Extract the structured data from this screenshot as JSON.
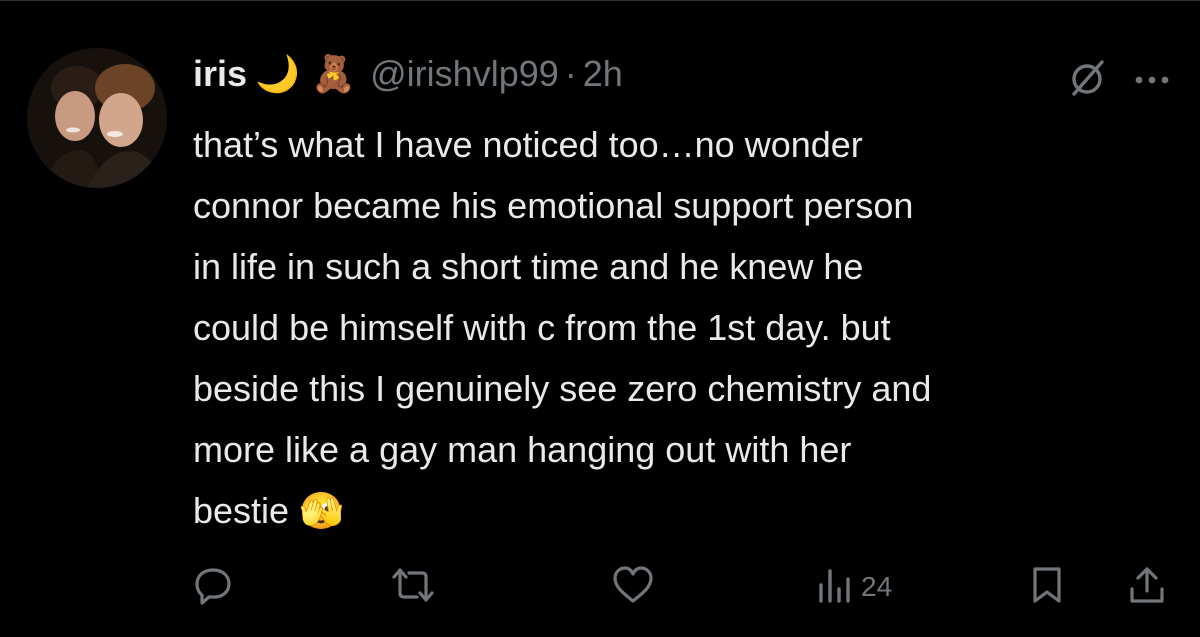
{
  "tweet": {
    "display_name": "iris",
    "name_emojis": "🌙 🧸",
    "handle": "@irishvlp99",
    "separator": "·",
    "time": "2h",
    "body_lines": [
      "that’s what I have noticed too…no wonder",
      "connor became his emotional support person",
      "in life in such a short time and he knew he",
      "could be himself with c from the 1st day. but",
      "beside this I genuinely see zero chemistry and",
      "more like a gay man hanging out with her",
      "bestie"
    ],
    "body_end_emoji": "🫣",
    "views_count": "24"
  },
  "icons": {
    "grok": "grok-icon",
    "more": "more-icon",
    "reply": "reply-icon",
    "retweet": "retweet-icon",
    "like": "like-icon",
    "views": "views-icon",
    "bookmark": "bookmark-icon",
    "share": "share-icon"
  },
  "colors": {
    "background": "#000000",
    "text_primary": "#e7e9ea",
    "text_secondary": "#71767b",
    "divider": "#2f3336"
  }
}
